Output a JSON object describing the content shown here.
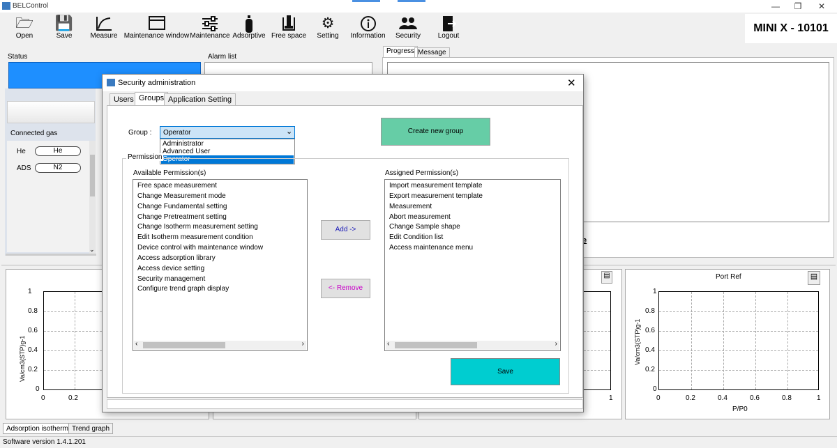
{
  "app": {
    "title": "BELControl",
    "model": "MINI X - 10101",
    "version": "Software version 1.4.1.201"
  },
  "toolbar": [
    {
      "label": "Open",
      "icon": "folder-icon"
    },
    {
      "label": "Save",
      "icon": "floppy-icon"
    },
    {
      "label": "Measure",
      "icon": "measure-curve-icon"
    },
    {
      "label": "Maintenance window",
      "icon": "window-icon"
    },
    {
      "label": "Maintenance",
      "icon": "sliders-icon"
    },
    {
      "label": "Adsorptive",
      "icon": "gas-cylinder-icon"
    },
    {
      "label": "Free space",
      "icon": "dewar-icon"
    },
    {
      "label": "Setting",
      "icon": "gear-icon"
    },
    {
      "label": "Information",
      "icon": "info-icon"
    },
    {
      "label": "Security",
      "icon": "users-icon"
    },
    {
      "label": "Logout",
      "icon": "logout-icon"
    }
  ],
  "main": {
    "status_label": "Status",
    "alarm_label": "Alarm list",
    "connected_gas_label": "Connected gas",
    "gases": [
      {
        "port": "He",
        "gas": "He"
      },
      {
        "port": "ADS",
        "gas": "N2"
      }
    ],
    "right_tabs": [
      "Progress",
      "Message"
    ],
    "bottom_tabs": [
      "Adsorption isotherm",
      "Trend graph"
    ]
  },
  "graphs": {
    "port_ref_title": "Port Ref",
    "ylabel": "Va/cm3(STP)g-1",
    "xlabel": "P/P0",
    "yticks": [
      "1",
      "0.8",
      "0.6",
      "0.4",
      "0.2",
      "0"
    ],
    "xticks": [
      "0",
      "0.2",
      "0.4",
      "0.6",
      "0.8",
      "1"
    ],
    "left_xticks": [
      "0",
      "0.2"
    ],
    "partial_xtick": "1"
  },
  "dialog": {
    "title": "Security administration",
    "tabs": [
      "Users",
      "Groups",
      "Application Setting"
    ],
    "active_tab": "Groups",
    "group_label": "Group :",
    "group_value": "Operator",
    "group_options": [
      "Administrator",
      "Advanced User",
      "Operator"
    ],
    "create_button": "Create new group",
    "permission_legend": "Permission",
    "available_label": "Available Permission(s)",
    "assigned_label": "Assigned Permission(s)",
    "available": [
      "Free space measurement",
      "Change Measurement mode",
      "Change Fundamental setting",
      "Change Pretreatment setting",
      "Change Isotherm measurement setting",
      "Edit Isotherm measurement condition",
      "Device control with maintenance window",
      "Access adsorption library",
      "Access device setting",
      "Security management",
      "Configure trend graph display"
    ],
    "assigned": [
      "Import measurement template",
      "Export measurement template",
      "Measurement",
      "Abort measurement",
      "Change Sample shape",
      "Edit Condition list",
      "Access maintenance menu"
    ],
    "add_button": "Add ->",
    "remove_button": "<- Remove",
    "save_button": "Save"
  },
  "colors": {
    "status": "#1e8fff",
    "create": "#66cda6",
    "save": "#00cdd0"
  }
}
